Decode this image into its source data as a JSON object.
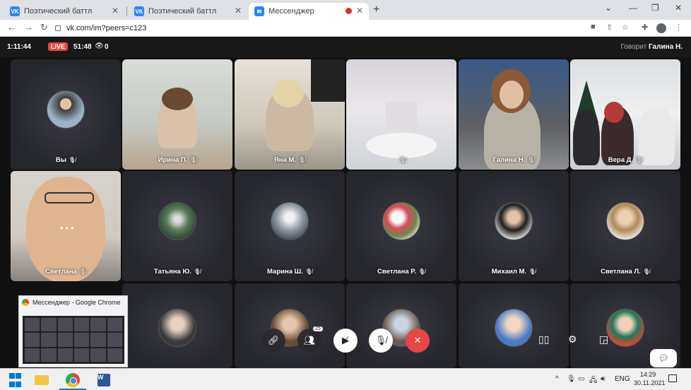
{
  "browser": {
    "tabs": [
      {
        "title": "Поэтический баттл",
        "favicon": "VK",
        "active": false
      },
      {
        "title": "Поэтический баттл",
        "favicon": "VK",
        "active": false
      },
      {
        "title": "Мессенджер",
        "favicon": "VK",
        "active": true,
        "recording": true
      }
    ],
    "url": "vk.com/im?peers=c123"
  },
  "call": {
    "timer": "1:11:44",
    "live_label": "LIVE",
    "live_time": "51:48",
    "viewers": "0",
    "speaking_prefix": "Говорит",
    "speaking_name": "Галина Н."
  },
  "participants": [
    {
      "name": "Вы",
      "kind": "avatar"
    },
    {
      "name": "Ирина П.",
      "kind": "video"
    },
    {
      "name": "Яна М.",
      "kind": "video"
    },
    {
      "name": "",
      "kind": "video"
    },
    {
      "name": "Галина Н.",
      "kind": "video"
    },
    {
      "name": "Вера Д.",
      "kind": "video"
    },
    {
      "name": "Светлана",
      "kind": "video"
    },
    {
      "name": "Татьяна Ю.",
      "kind": "avatar"
    },
    {
      "name": "Марина Ш.",
      "kind": "avatar"
    },
    {
      "name": "Светлана Р.",
      "kind": "avatar"
    },
    {
      "name": "Михаил М.",
      "kind": "avatar"
    },
    {
      "name": "Светлана Л.",
      "kind": "avatar"
    }
  ],
  "controls": {
    "participants_count": "25"
  },
  "preview": {
    "title": "Мессенджер - Google Chrome"
  },
  "taskbar": {
    "lang": "ENG",
    "time": "14:29",
    "date": "30.11.2021"
  },
  "colors": {
    "live": "#e64646",
    "vk_blue": "#2787f5",
    "end_call": "#e64646"
  }
}
